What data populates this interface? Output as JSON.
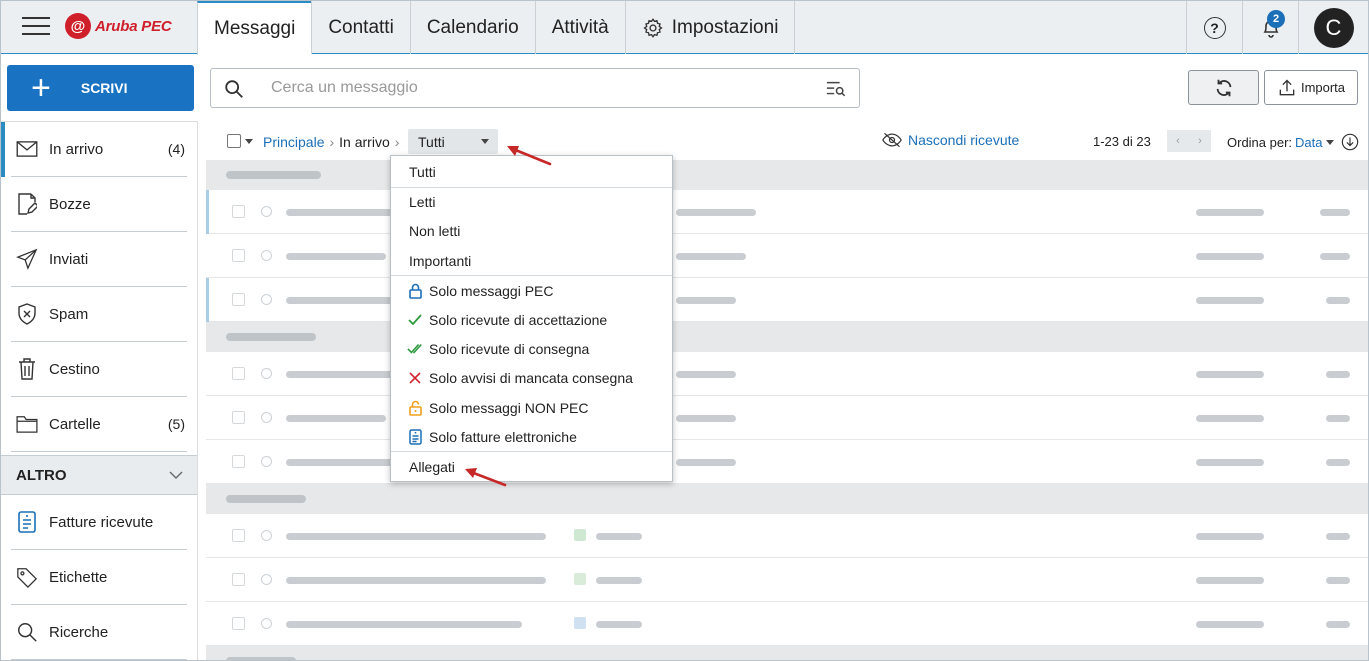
{
  "app": {
    "brand": "Aruba PEC"
  },
  "tabs": [
    {
      "label": "Messaggi"
    },
    {
      "label": "Contatti"
    },
    {
      "label": "Calendario"
    },
    {
      "label": "Attività"
    },
    {
      "label": "Impostazioni"
    }
  ],
  "header": {
    "help_symbol": "?",
    "notifications_count": "2",
    "avatar_initial": "C"
  },
  "toolbar": {
    "compose_label": "SCRIVI",
    "search_placeholder": "Cerca un messaggio",
    "import_label": "Importa"
  },
  "sidebar": {
    "items": [
      {
        "label": "In arrivo",
        "count": "(4)",
        "icon": "inbox-icon"
      },
      {
        "label": "Bozze",
        "count": "",
        "icon": "draft-icon"
      },
      {
        "label": "Inviati",
        "count": "",
        "icon": "send-icon"
      },
      {
        "label": "Spam",
        "count": "",
        "icon": "spam-shield-icon"
      },
      {
        "label": "Cestino",
        "count": "",
        "icon": "trash-icon"
      },
      {
        "label": "Cartelle",
        "count": "(5)",
        "icon": "folder-icon"
      }
    ],
    "section_label": "ALTRO",
    "extra_items": [
      {
        "label": "Fatture ricevute",
        "icon": "invoice-icon"
      },
      {
        "label": "Etichette",
        "icon": "tag-icon"
      },
      {
        "label": "Ricerche",
        "icon": "search-icon"
      }
    ]
  },
  "list_header": {
    "breadcrumb_root": "Principale",
    "breadcrumb_current": "In arrivo",
    "filter_value": "Tutti",
    "hide_receipts": "Nascondi ricevute",
    "page_info": "1-23 di 23",
    "sort_label": "Ordina per:",
    "sort_value": "Data"
  },
  "filter_menu": {
    "items": [
      {
        "label": "Tutti",
        "icon": ""
      },
      {
        "label": "Letti",
        "icon": ""
      },
      {
        "label": "Non letti",
        "icon": ""
      },
      {
        "label": "Importanti",
        "icon": ""
      },
      {
        "label": "Solo messaggi PEC",
        "icon": "lock-icon",
        "color": "#1b6fb8"
      },
      {
        "label": "Solo ricevute di accettazione",
        "icon": "check-icon",
        "color": "#2e9a3e"
      },
      {
        "label": "Solo ricevute di consegna",
        "icon": "double-check-icon",
        "color": "#2e9a3e"
      },
      {
        "label": "Solo avvisi di mancata consegna",
        "icon": "x-icon",
        "color": "#d0242f"
      },
      {
        "label": "Solo messaggi NON PEC",
        "icon": "unlock-icon",
        "color": "#f0a01c"
      },
      {
        "label": "Solo fatture elettroniche",
        "icon": "invoice-icon",
        "color": "#1b6fb8"
      },
      {
        "label": "Allegati",
        "icon": ""
      }
    ]
  },
  "colors": {
    "accent": "#1a72c3",
    "brand_red": "#cf1f2a",
    "annotation_arrow": "#c62828"
  }
}
